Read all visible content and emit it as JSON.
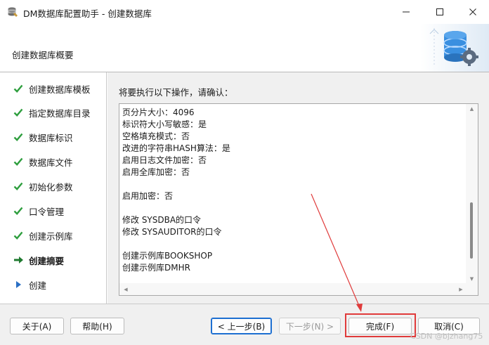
{
  "window": {
    "title": "DM数据库配置助手 - 创建数据库",
    "icon": "database-config-icon",
    "controls": [
      "minimize-icon",
      "maximize-icon",
      "close-icon"
    ]
  },
  "header": {
    "title": "创建数据库概要",
    "art_icon": "database-gear-icon"
  },
  "sidebar": {
    "steps": [
      {
        "label": "创建数据库模板",
        "state": "done",
        "icon": "check-icon"
      },
      {
        "label": "指定数据库目录",
        "state": "done",
        "icon": "check-icon"
      },
      {
        "label": "数据库标识",
        "state": "done",
        "icon": "check-icon"
      },
      {
        "label": "数据库文件",
        "state": "done",
        "icon": "check-icon"
      },
      {
        "label": "初始化参数",
        "state": "done",
        "icon": "check-icon"
      },
      {
        "label": "口令管理",
        "state": "done",
        "icon": "check-icon"
      },
      {
        "label": "创建示例库",
        "state": "done",
        "icon": "check-icon"
      },
      {
        "label": "创建摘要",
        "state": "current",
        "icon": "arrow-right-icon"
      },
      {
        "label": "创建",
        "state": "pending",
        "icon": "triangle-right-icon"
      }
    ]
  },
  "main": {
    "prompt": "将要执行以下操作，请确认：",
    "summary_lines": [
      "页分片大小：4096",
      "标识符大小写敏感：是",
      "空格填充模式：否",
      "改进的字符串HASH算法：是",
      "启用日志文件加密：否",
      "启用全库加密：否",
      "",
      "启用加密：否",
      "",
      "修改 SYSDBA的口令",
      "修改 SYSAUDITOR的口令",
      "",
      "创建示例库BOOKSHOP",
      "创建示例库DMHR"
    ],
    "scroll_position": 0.85
  },
  "footer": {
    "about": "关于(A)",
    "help": "帮助(H)",
    "prev": "< 上一步(B)",
    "next": "下一步(N) >",
    "finish": "完成(F)",
    "cancel": "取消(C)"
  },
  "watermark": "CSDN @bjzhang75",
  "colors": {
    "check": "#2e9e3e",
    "arrow": "#1f7a2f",
    "pending": "#2a6fc4",
    "annotation": "#e03b3b",
    "default_button_border": "#1d6fd1"
  }
}
